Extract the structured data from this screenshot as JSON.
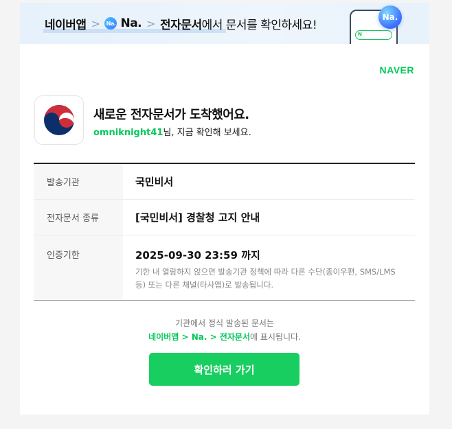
{
  "banner": {
    "app_name": "네이버앱",
    "separator": ">",
    "na_logo": "Na.",
    "na_label": "Na.",
    "doc_label": "전자문서",
    "suffix": "에서 문서를 확인하세요!",
    "phone_search_letter": "N",
    "bubble_label": "Na."
  },
  "brand": {
    "logo": "NAVER",
    "color": "#03c75a"
  },
  "message": {
    "title": "새로운 전자문서가 도착했어요.",
    "username": "omniknight41",
    "subtitle_rest": "님, 지금 확인해 보세요.",
    "icon": "korea-government-emblem-icon"
  },
  "details": {
    "sender_label": "발송기관",
    "sender_value": "국민비서",
    "doc_type_label": "전자문서 종류",
    "doc_type_value": "[국민비서] 경찰청 고지 안내",
    "deadline_label": "인증기한",
    "deadline_value": "2025-09-30 23:59 까지",
    "deadline_note": "기한 내 열람하지 않으면 발송기관 정책에 따라 다른 수단(종이우편, SMS/LMS 등) 또는 다른 채널(타사앱)로 발송됩니다."
  },
  "footer": {
    "line1": "기관에서 정식 발송된 문서는",
    "path": "네이버앱 > Na. > 전자문서",
    "line2_rest": "에 표시됩니다."
  },
  "cta": {
    "label": "확인하러 가기",
    "color": "#19ce60"
  }
}
